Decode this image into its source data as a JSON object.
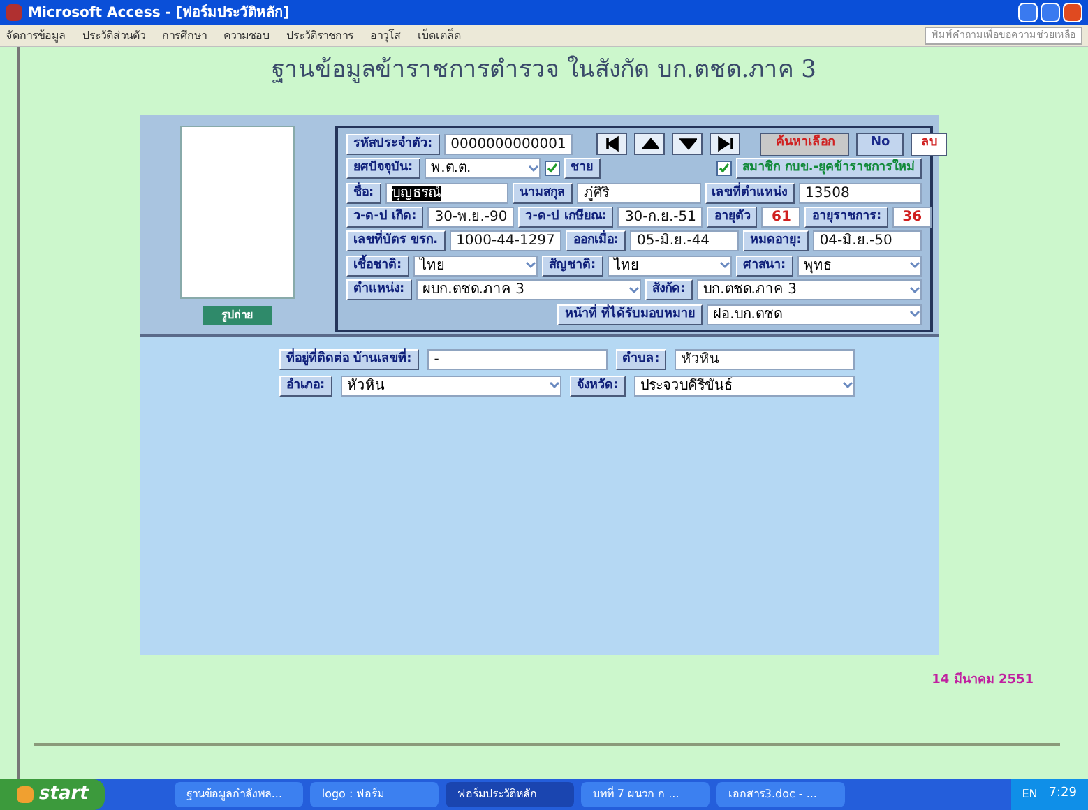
{
  "window": {
    "title": "Microsoft Access - [ฟอร์มประวัติหลัก]"
  },
  "menu": [
    "จัดการข้อมูล",
    "ประวัติส่วนตัว",
    "การศึกษา",
    "ความชอบ",
    "ประวัติราชการ",
    "อาวุโส",
    "เบ็ดเตล็ด"
  ],
  "help_box": {
    "placeholder": "พิมพ์คำถามเพื่อขอความช่วยเหลือ"
  },
  "heading": "ฐานข้อมูลข้าราชการตำรวจ ในสังกัด บก.ตชด.ภาค 3",
  "photo_button": "รูปถ่าย",
  "nav": [
    {
      "kind": "first"
    },
    {
      "kind": "prev"
    },
    {
      "kind": "next"
    },
    {
      "kind": "last"
    }
  ],
  "actions": [
    {
      "label": "ค้นหาเลือก",
      "kind": "search"
    },
    {
      "label": "No",
      "kind": "no"
    },
    {
      "label": "ลบ",
      "kind": "delete"
    }
  ],
  "rows": [
    [
      {
        "kind": "label",
        "text": "รหัสประจำตัว:"
      },
      {
        "kind": "field",
        "text": "0000000000001"
      }
    ],
    [
      {
        "kind": "label",
        "text": "ยศปัจจุบัน:"
      },
      {
        "kind": "combo",
        "text": "พ.ต.ต."
      },
      {
        "kind": "checkbox",
        "checked": true
      },
      {
        "kind": "label",
        "text": "ชาย"
      },
      {
        "kind": "gap"
      },
      {
        "kind": "checkbox",
        "checked": true
      },
      {
        "kind": "option",
        "text": "สมาชิก กบข.-ยุคข้าราชการใหม่"
      }
    ],
    [
      {
        "kind": "label",
        "text": "ชื่อ:"
      },
      {
        "kind": "field",
        "text": "บุญธรณ์",
        "highlighted": true
      },
      {
        "kind": "label",
        "text": "นามสกุล"
      },
      {
        "kind": "field",
        "text": "ภู่ศิริ"
      },
      {
        "kind": "label",
        "text": "เลขที่ตำแหน่ง"
      },
      {
        "kind": "field",
        "text": "13508"
      }
    ],
    [
      {
        "kind": "label",
        "text": "ว-ด-ป เกิด:"
      },
      {
        "kind": "field",
        "text": "30-พ.ย.-90"
      },
      {
        "kind": "label",
        "text": "ว-ด-ป เกษียณ:"
      },
      {
        "kind": "field",
        "text": "30-ก.ย.-51"
      },
      {
        "kind": "label",
        "text": "อายุตัว"
      },
      {
        "kind": "number",
        "text": "61"
      },
      {
        "kind": "label",
        "text": "อายุราชการ:"
      },
      {
        "kind": "number",
        "text": "36"
      }
    ],
    [
      {
        "kind": "label",
        "text": "เลขที่บัตร ขรก."
      },
      {
        "kind": "field",
        "text": "1000-44-1297",
        "highlighted": false
      },
      {
        "kind": "label",
        "text": "ออกเมื่อ:"
      },
      {
        "kind": "field",
        "text": "05-มิ.ย.-44"
      },
      {
        "kind": "label",
        "text": "หมดอายุ:"
      },
      {
        "kind": "field",
        "text": "04-มิ.ย.-50"
      }
    ],
    [
      {
        "kind": "label",
        "text": "เชื้อชาติ:"
      },
      {
        "kind": "combo",
        "text": "ไทย"
      },
      {
        "kind": "label",
        "text": "สัญชาติ:"
      },
      {
        "kind": "combo",
        "text": "ไทย"
      },
      {
        "kind": "label",
        "text": "ศาสนา:"
      },
      {
        "kind": "combo",
        "text": "พุทธ"
      }
    ],
    [
      {
        "kind": "label",
        "text": "ตำแหน่ง:"
      },
      {
        "kind": "combo",
        "text": "ผบก.ตชด.ภาค 3"
      },
      {
        "kind": "label",
        "text": "สังกัด:"
      },
      {
        "kind": "combo",
        "text": "บก.ตชด.ภาค 3"
      }
    ],
    [
      {
        "kind": "gap"
      },
      {
        "kind": "label",
        "text": "หน้าที่ ที่ได้รับมอบหมาย"
      },
      {
        "kind": "combo",
        "text": "ฝอ.บก.ตชด"
      }
    ]
  ],
  "address_rows": [
    [
      {
        "kind": "label",
        "text": "ที่อยู่ที่ติดต่อ บ้านเลขที่:"
      },
      {
        "kind": "field",
        "text": "-"
      },
      {
        "kind": "label",
        "text": "ตำบล:"
      },
      {
        "kind": "field",
        "text": "หัวหิน"
      }
    ],
    [
      {
        "kind": "label",
        "text": "อำเภอ:"
      },
      {
        "kind": "combo",
        "text": "หัวหิน"
      },
      {
        "kind": "label",
        "text": "จังหวัด:"
      },
      {
        "kind": "combo",
        "text": "ประจวบคีรีขันธ์"
      }
    ]
  ],
  "date": "14 มีนาคม 2551",
  "taskbar": {
    "start": "start",
    "tasks": [
      {
        "label": "ฐานข้อมูลกำลังพล...",
        "selected": false
      },
      {
        "label": "logo : ฟอร์ม",
        "selected": false
      },
      {
        "label": "ฟอร์มประวัติหลัก",
        "selected": true
      },
      {
        "label": "บทที่ 7 ผนวก ก ...",
        "selected": false
      },
      {
        "label": "เอกสาร3.doc - ...",
        "selected": false
      }
    ],
    "language": "EN",
    "clock": "7:29"
  }
}
